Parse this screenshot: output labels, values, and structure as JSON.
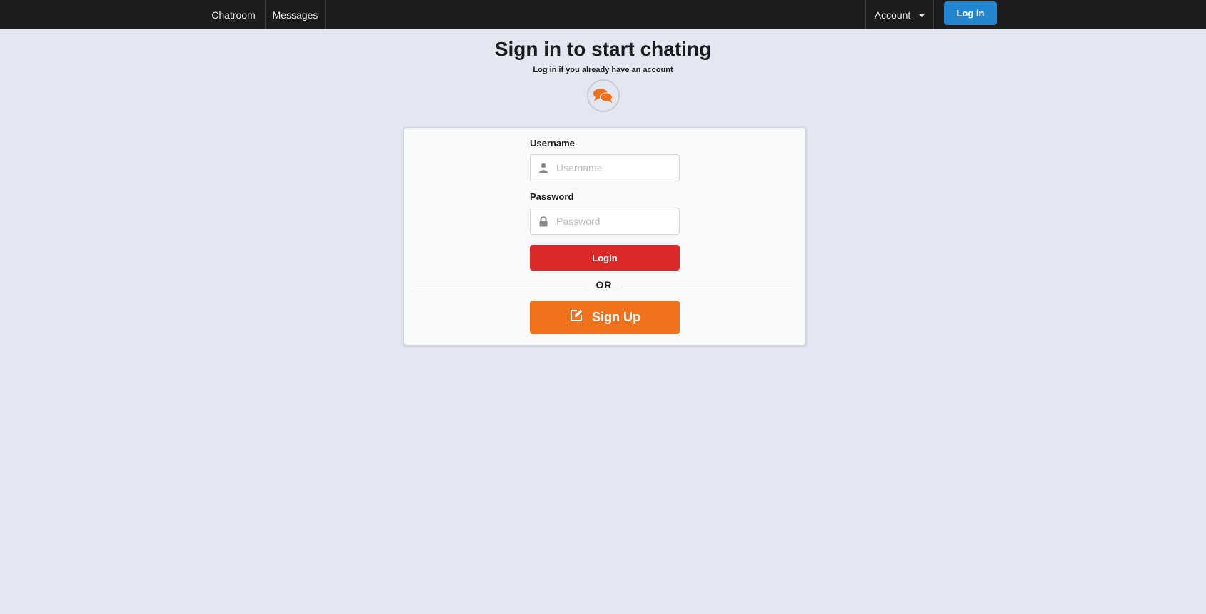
{
  "nav": {
    "chatroom": "Chatroom",
    "messages": "Messages",
    "account": "Account",
    "login_button": "Log in"
  },
  "header": {
    "title": "Sign in to start chating",
    "subtitle": "Log in if you already have an account",
    "icon": "comments-icon"
  },
  "form": {
    "username_label": "Username",
    "username_placeholder": "Username",
    "username_value": "",
    "password_label": "Password",
    "password_placeholder": "Password",
    "password_value": "",
    "login_button": "Login",
    "divider": "OR",
    "signup_button": "Sign Up"
  },
  "colors": {
    "nav_bg": "#1b1c1d",
    "page_bg": "#e3e7f1",
    "primary_blue": "#2185d0",
    "login_red": "#db2828",
    "signup_orange": "#f2711c",
    "icon_orange": "#f2711c"
  }
}
